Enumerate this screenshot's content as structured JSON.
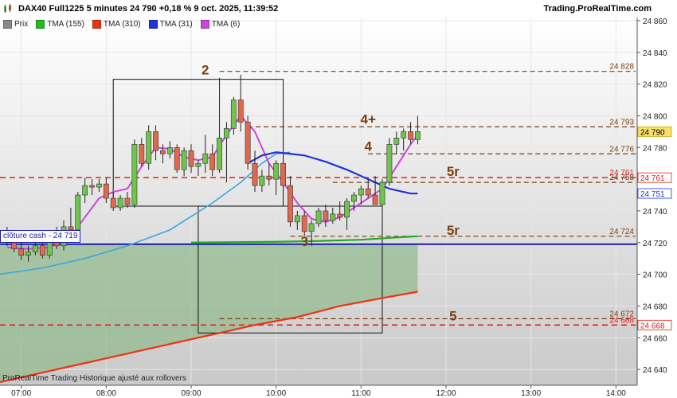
{
  "header": {
    "title": "DAX40 Full1225 5 minutes 24 790 +0,18 % 9 oct. 2025, 11:39:52",
    "brand": "Trading.ProRealTime.com"
  },
  "legend": [
    {
      "label": "Prix",
      "color": "#888888"
    },
    {
      "label": "TMA (155)",
      "color": "#22bb22"
    },
    {
      "label": "TMA (310)",
      "color": "#ee3311"
    },
    {
      "label": "TMA (31)",
      "color": "#2233dd"
    },
    {
      "label": "TMA (6)",
      "color": "#cc44dd"
    }
  ],
  "footer": "ProRealTime Trading  Historique ajusté aux rollovers",
  "cash_label": "clôture cash -  24 719",
  "chart_data": {
    "type": "candlestick",
    "ylim": [
      24630,
      24862
    ],
    "yticks": [
      24640,
      24660,
      24680,
      24700,
      24720,
      24740,
      24760,
      24780,
      24800,
      24820,
      24840,
      24860
    ],
    "ytick_labels": [
      "24 640",
      "24 660",
      "24 680",
      "24 700",
      "24 720",
      "24 740",
      "24 760",
      "24 780",
      "24 800",
      "24 820",
      "24 840",
      "24 860"
    ],
    "xlim": [
      "06:45",
      "14:15"
    ],
    "xticks": [
      {
        "time": "07:00",
        "label": "07:00"
      },
      {
        "time": "08:00",
        "label": "08:00"
      },
      {
        "time": "09:00",
        "label": "09:00"
      },
      {
        "time": "10:00",
        "label": "10:00"
      },
      {
        "time": "11:00",
        "label": "11:00"
      },
      {
        "time": "12:00",
        "label": "12:00"
      },
      {
        "time": "13:00",
        "label": "13:00"
      },
      {
        "time": "14:00",
        "label": "14:00"
      }
    ],
    "colors": {
      "up": "#6fc44c",
      "down": "#e0694d"
    },
    "candles": [
      {
        "t": "06:50",
        "o": 24724,
        "h": 24730,
        "l": 24718,
        "c": 24720
      },
      {
        "t": "06:55",
        "o": 24720,
        "h": 24726,
        "l": 24714,
        "c": 24716
      },
      {
        "t": "07:00",
        "o": 24716,
        "h": 24720,
        "l": 24709,
        "c": 24712
      },
      {
        "t": "07:05",
        "o": 24712,
        "h": 24718,
        "l": 24708,
        "c": 24714
      },
      {
        "t": "07:10",
        "o": 24714,
        "h": 24722,
        "l": 24712,
        "c": 24718
      },
      {
        "t": "07:15",
        "o": 24718,
        "h": 24720,
        "l": 24710,
        "c": 24712
      },
      {
        "t": "07:20",
        "o": 24712,
        "h": 24726,
        "l": 24710,
        "c": 24722
      },
      {
        "t": "07:25",
        "o": 24722,
        "h": 24730,
        "l": 24716,
        "c": 24718
      },
      {
        "t": "07:30",
        "o": 24718,
        "h": 24734,
        "l": 24715,
        "c": 24730
      },
      {
        "t": "07:35",
        "o": 24730,
        "h": 24742,
        "l": 24726,
        "c": 24728
      },
      {
        "t": "07:40",
        "o": 24728,
        "h": 24752,
        "l": 24726,
        "c": 24750
      },
      {
        "t": "07:45",
        "o": 24750,
        "h": 24761,
        "l": 24745,
        "c": 24756
      },
      {
        "t": "07:50",
        "o": 24756,
        "h": 24760,
        "l": 24750,
        "c": 24755
      },
      {
        "t": "07:55",
        "o": 24755,
        "h": 24760,
        "l": 24752,
        "c": 24757
      },
      {
        "t": "08:00",
        "o": 24757,
        "h": 24761,
        "l": 24745,
        "c": 24748
      },
      {
        "t": "08:05",
        "o": 24748,
        "h": 24752,
        "l": 24740,
        "c": 24742
      },
      {
        "t": "08:10",
        "o": 24742,
        "h": 24750,
        "l": 24740,
        "c": 24748
      },
      {
        "t": "08:15",
        "o": 24748,
        "h": 24752,
        "l": 24742,
        "c": 24744
      },
      {
        "t": "08:20",
        "o": 24744,
        "h": 24785,
        "l": 24742,
        "c": 24782
      },
      {
        "t": "08:25",
        "o": 24782,
        "h": 24786,
        "l": 24768,
        "c": 24770
      },
      {
        "t": "08:30",
        "o": 24770,
        "h": 24794,
        "l": 24766,
        "c": 24790
      },
      {
        "t": "08:35",
        "o": 24790,
        "h": 24794,
        "l": 24772,
        "c": 24778
      },
      {
        "t": "08:40",
        "o": 24778,
        "h": 24782,
        "l": 24770,
        "c": 24776
      },
      {
        "t": "08:45",
        "o": 24776,
        "h": 24784,
        "l": 24773,
        "c": 24780
      },
      {
        "t": "08:50",
        "o": 24780,
        "h": 24782,
        "l": 24764,
        "c": 24766
      },
      {
        "t": "08:55",
        "o": 24766,
        "h": 24780,
        "l": 24762,
        "c": 24778
      },
      {
        "t": "09:00",
        "o": 24778,
        "h": 24782,
        "l": 24764,
        "c": 24768
      },
      {
        "t": "09:05",
        "o": 24768,
        "h": 24772,
        "l": 24762,
        "c": 24770
      },
      {
        "t": "09:10",
        "o": 24770,
        "h": 24788,
        "l": 24764,
        "c": 24776
      },
      {
        "t": "09:15",
        "o": 24776,
        "h": 24782,
        "l": 24762,
        "c": 24766
      },
      {
        "t": "09:20",
        "o": 24766,
        "h": 24824,
        "l": 24764,
        "c": 24786
      },
      {
        "t": "09:25",
        "o": 24786,
        "h": 24796,
        "l": 24758,
        "c": 24792
      },
      {
        "t": "09:30",
        "o": 24792,
        "h": 24812,
        "l": 24788,
        "c": 24810
      },
      {
        "t": "09:35",
        "o": 24810,
        "h": 24826,
        "l": 24790,
        "c": 24796
      },
      {
        "t": "09:40",
        "o": 24796,
        "h": 24800,
        "l": 24766,
        "c": 24770
      },
      {
        "t": "09:45",
        "o": 24770,
        "h": 24778,
        "l": 24752,
        "c": 24756
      },
      {
        "t": "09:50",
        "o": 24756,
        "h": 24766,
        "l": 24752,
        "c": 24762
      },
      {
        "t": "09:55",
        "o": 24762,
        "h": 24770,
        "l": 24756,
        "c": 24760
      },
      {
        "t": "10:00",
        "o": 24760,
        "h": 24772,
        "l": 24750,
        "c": 24770
      },
      {
        "t": "10:05",
        "o": 24770,
        "h": 24776,
        "l": 24752,
        "c": 24756
      },
      {
        "t": "10:10",
        "o": 24756,
        "h": 24762,
        "l": 24730,
        "c": 24733
      },
      {
        "t": "10:15",
        "o": 24733,
        "h": 24740,
        "l": 24728,
        "c": 24737
      },
      {
        "t": "10:20",
        "o": 24737,
        "h": 24740,
        "l": 24724,
        "c": 24727
      },
      {
        "t": "10:25",
        "o": 24727,
        "h": 24734,
        "l": 24718,
        "c": 24732
      },
      {
        "t": "10:30",
        "o": 24732,
        "h": 24742,
        "l": 24730,
        "c": 24740
      },
      {
        "t": "10:35",
        "o": 24740,
        "h": 24744,
        "l": 24730,
        "c": 24734
      },
      {
        "t": "10:40",
        "o": 24734,
        "h": 24742,
        "l": 24732,
        "c": 24738
      },
      {
        "t": "10:45",
        "o": 24738,
        "h": 24746,
        "l": 24734,
        "c": 24736
      },
      {
        "t": "10:50",
        "o": 24736,
        "h": 24748,
        "l": 24728,
        "c": 24746
      },
      {
        "t": "10:55",
        "o": 24746,
        "h": 24752,
        "l": 24740,
        "c": 24750
      },
      {
        "t": "11:00",
        "o": 24750,
        "h": 24756,
        "l": 24744,
        "c": 24754
      },
      {
        "t": "11:05",
        "o": 24754,
        "h": 24760,
        "l": 24748,
        "c": 24750
      },
      {
        "t": "11:10",
        "o": 24750,
        "h": 24762,
        "l": 24746,
        "c": 24744
      },
      {
        "t": "11:15",
        "o": 24744,
        "h": 24760,
        "l": 24742,
        "c": 24758
      },
      {
        "t": "11:20",
        "o": 24758,
        "h": 24786,
        "l": 24756,
        "c": 24782
      },
      {
        "t": "11:25",
        "o": 24782,
        "h": 24790,
        "l": 24776,
        "c": 24786
      },
      {
        "t": "11:30",
        "o": 24786,
        "h": 24792,
        "l": 24778,
        "c": 24790
      },
      {
        "t": "11:35",
        "o": 24790,
        "h": 24796,
        "l": 24782,
        "c": 24785
      },
      {
        "t": "11:40",
        "o": 24785,
        "h": 24800,
        "l": 24782,
        "c": 24790
      }
    ],
    "indicators": [
      {
        "name": "TMA (6)",
        "color": "#cc44dd",
        "points": [
          [
            "06:50",
            24717
          ],
          [
            "07:05",
            24716
          ],
          [
            "07:20",
            24717
          ],
          [
            "07:35",
            24724
          ],
          [
            "07:45",
            24736
          ],
          [
            "07:55",
            24748
          ],
          [
            "08:05",
            24752
          ],
          [
            "08:15",
            24754
          ],
          [
            "08:25",
            24768
          ],
          [
            "08:35",
            24780
          ],
          [
            "08:45",
            24779
          ],
          [
            "08:55",
            24774
          ],
          [
            "09:05",
            24772
          ],
          [
            "09:15",
            24774
          ],
          [
            "09:25",
            24788
          ],
          [
            "09:35",
            24800
          ],
          [
            "09:45",
            24790
          ],
          [
            "09:55",
            24770
          ],
          [
            "10:05",
            24758
          ],
          [
            "10:15",
            24745
          ],
          [
            "10:25",
            24735
          ],
          [
            "10:35",
            24733
          ],
          [
            "10:45",
            24736
          ],
          [
            "10:55",
            24742
          ],
          [
            "11:05",
            24748
          ],
          [
            "11:15",
            24754
          ],
          [
            "11:25",
            24768
          ],
          [
            "11:35",
            24782
          ],
          [
            "11:40",
            24788
          ]
        ]
      },
      {
        "name": "TMA (31)",
        "color": "#2233dd",
        "points": [
          [
            "09:40",
            24770
          ],
          [
            "09:50",
            24775
          ],
          [
            "10:00",
            24777
          ],
          [
            "10:10",
            24776
          ],
          [
            "10:20",
            24775
          ],
          [
            "10:35",
            24771
          ],
          [
            "10:50",
            24766
          ],
          [
            "11:05",
            24760
          ],
          [
            "11:20",
            24754
          ],
          [
            "11:35",
            24751
          ],
          [
            "11:40",
            24751
          ]
        ]
      },
      {
        "name": "TMA (155)",
        "color": "#22aa22",
        "points": [
          [
            "09:00",
            24720
          ],
          [
            "09:30",
            24720.3
          ],
          [
            "10:00",
            24720.5
          ],
          [
            "10:30",
            24721
          ],
          [
            "11:00",
            24721.8
          ],
          [
            "11:20",
            24723
          ],
          [
            "11:40",
            24724
          ]
        ]
      },
      {
        "name": "TMA (310)",
        "color": "#ee3311",
        "points": [
          [
            "06:45",
            24632
          ],
          [
            "07:15",
            24638
          ],
          [
            "07:45",
            24644
          ],
          [
            "08:15",
            24650
          ],
          [
            "08:45",
            24656
          ],
          [
            "09:15",
            24662
          ],
          [
            "09:45",
            24668
          ],
          [
            "10:15",
            24673
          ],
          [
            "10:45",
            24680
          ],
          [
            "11:15",
            24685
          ],
          [
            "11:40",
            24689
          ]
        ]
      }
    ],
    "ma_light_blue": {
      "color": "#3aa6e0",
      "points": [
        [
          "06:45",
          24700
        ],
        [
          "07:15",
          24704
        ],
        [
          "07:45",
          24710
        ],
        [
          "08:15",
          24718
        ],
        [
          "08:45",
          24728
        ],
        [
          "09:15",
          24745
        ],
        [
          "09:35",
          24758
        ],
        [
          "09:50",
          24770
        ],
        [
          "10:00",
          24776
        ],
        [
          "10:10",
          24777
        ]
      ]
    },
    "cash_close": 24719,
    "levels": [
      {
        "value": 24828,
        "label": "24 828",
        "color": "#7b3f12",
        "style": "dashed",
        "from": "09:20"
      },
      {
        "value": 24793,
        "label": "24 793",
        "color": "#7b3f12",
        "style": "dashed",
        "from": "09:40"
      },
      {
        "value": 24776,
        "label": "24 776",
        "color": "#7b3f12",
        "style": "dashed",
        "from": "11:05"
      },
      {
        "value": 24761,
        "label": "24 761",
        "color": "#e02020",
        "style": "dashed",
        "from": "06:45"
      },
      {
        "value": 24758,
        "label": "24 758",
        "color": "#7b3f12",
        "style": "dashed",
        "from": "10:40"
      },
      {
        "value": 24724,
        "label": "24 724",
        "color": "#7b3f12",
        "style": "dashed",
        "from": "10:10"
      },
      {
        "value": 24672,
        "label": "24 672",
        "color": "#7b3f12",
        "style": "dashed",
        "from": "09:20"
      },
      {
        "value": 24668,
        "label": "24 668",
        "color": "#e02020",
        "style": "dashed",
        "from": "06:45"
      }
    ],
    "boxes": [
      {
        "t0": "08:05",
        "t1": "10:05",
        "y0": 24743,
        "y1": 24823
      },
      {
        "t0": "09:05",
        "t1": "11:15",
        "y0": 24663,
        "y1": 24743
      }
    ],
    "annotations": [
      {
        "text": "2",
        "t": "09:10",
        "y": 24826
      },
      {
        "text": "3",
        "t": "10:20",
        "y": 24718
      },
      {
        "text": "4+",
        "t": "11:05",
        "y": 24795
      },
      {
        "text": "4",
        "t": "11:05",
        "y": 24778
      },
      {
        "text": "5r",
        "t": "12:05",
        "y": 24762
      },
      {
        "text": "5r",
        "t": "12:05",
        "y": 24725
      },
      {
        "text": "5",
        "t": "12:05",
        "y": 24671
      }
    ],
    "price_tags": [
      {
        "value": 24790,
        "label": "24 790",
        "bg": "#f7e06a",
        "fg": "#000000"
      },
      {
        "value": 24751,
        "label": "24 751",
        "bg": "#ffffff",
        "fg": "#2233dd"
      },
      {
        "value": 24761,
        "label": "24 761",
        "bg": "#ffffff",
        "fg": "#e02020"
      },
      {
        "value": 24668,
        "label": "24 668",
        "bg": "#ffffff",
        "fg": "#e02020"
      }
    ]
  }
}
